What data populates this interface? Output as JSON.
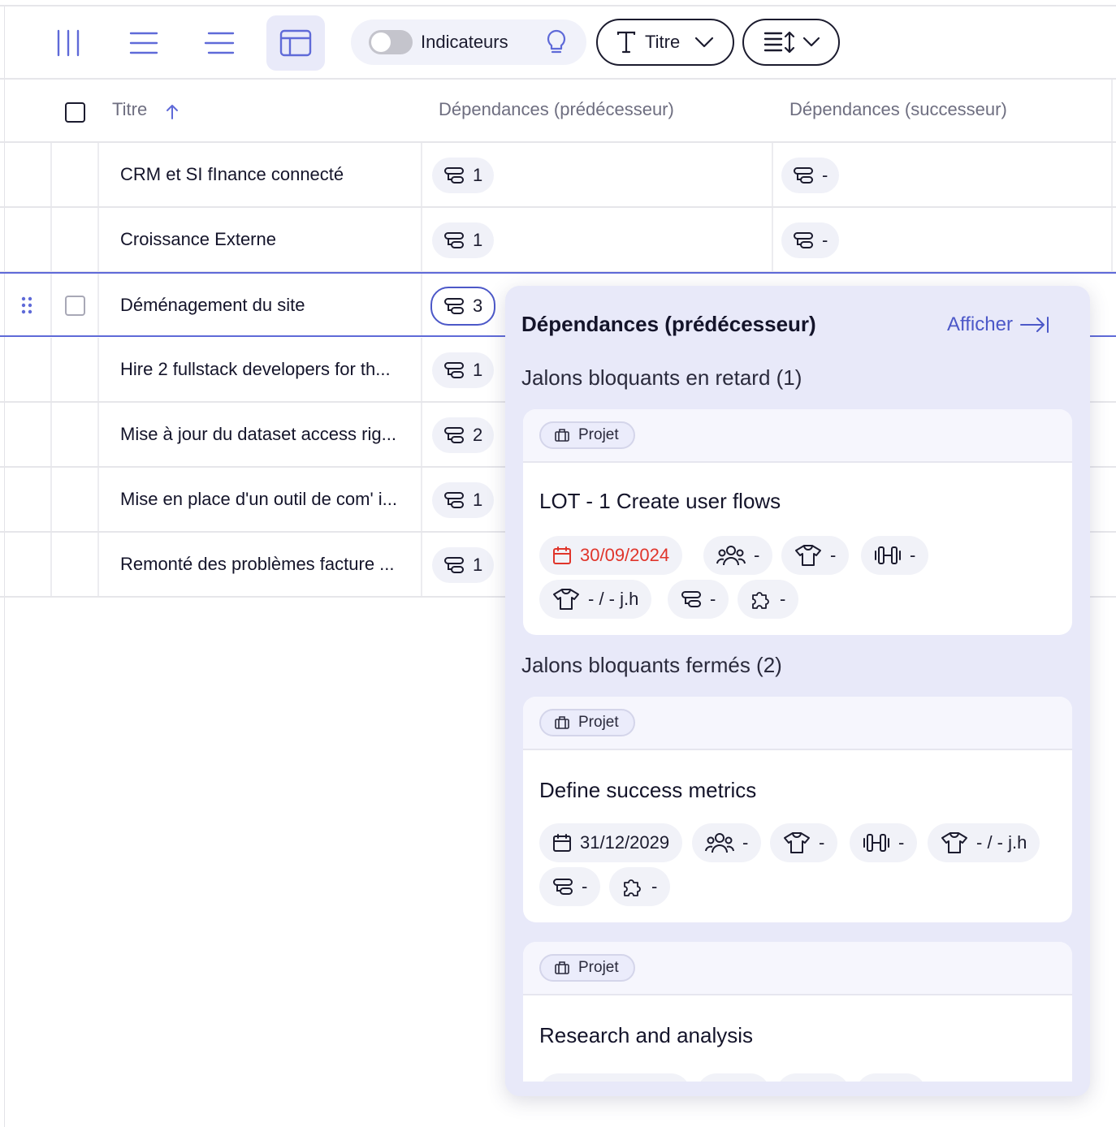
{
  "toolbar": {
    "view_icons": [
      "columns-icon",
      "list-icon",
      "list-indent-icon",
      "table-layout-icon"
    ],
    "indicators_label": "Indicateurs",
    "title_button_label": "Titre"
  },
  "table": {
    "headers": {
      "title": "Titre",
      "pred": "Dépendances (prédécesseur)",
      "succ": "Dépendances (successeur)"
    },
    "rows": [
      {
        "title": "CRM et SI fInance connecté",
        "pred": "1",
        "succ": "-"
      },
      {
        "title": "Croissance Externe",
        "pred": "1",
        "succ": "-"
      },
      {
        "title": "Déménagement du site",
        "pred": "3",
        "succ": ""
      },
      {
        "title": "Hire 2 fullstack developers for th...",
        "pred": "1",
        "succ": ""
      },
      {
        "title": "Mise à jour du dataset access rig...",
        "pred": "2",
        "succ": ""
      },
      {
        "title": "Mise en place d'un outil de com' i...",
        "pred": "1",
        "succ": ""
      },
      {
        "title": "Remonté des problèmes facture ...",
        "pred": "1",
        "succ": ""
      }
    ]
  },
  "popover": {
    "title": "Dépendances (prédécesseur)",
    "link": "Afficher",
    "late_section": "Jalons bloquants en retard (1)",
    "closed_section": "Jalons bloquants fermés (2)",
    "cards": [
      {
        "badge": "Projet",
        "title": "LOT - 1 Create user flows",
        "date": "30/09/2024",
        "team": "-",
        "shirt": "-",
        "weight": "-",
        "effort": "- / - j.h",
        "deps": "-",
        "puzzle": "-"
      },
      {
        "badge": "Projet",
        "title": "Define success metrics",
        "date": "31/12/2029",
        "team": "-",
        "shirt": "-",
        "weight": "-",
        "effort": "- / - j.h",
        "deps": "-",
        "puzzle": "-"
      },
      {
        "badge": "Projet",
        "title": "Research and analysis"
      }
    ]
  },
  "colors": {
    "accent": "#4c58c8",
    "late": "#e0352b",
    "popover_bg": "#e8e9f9"
  }
}
